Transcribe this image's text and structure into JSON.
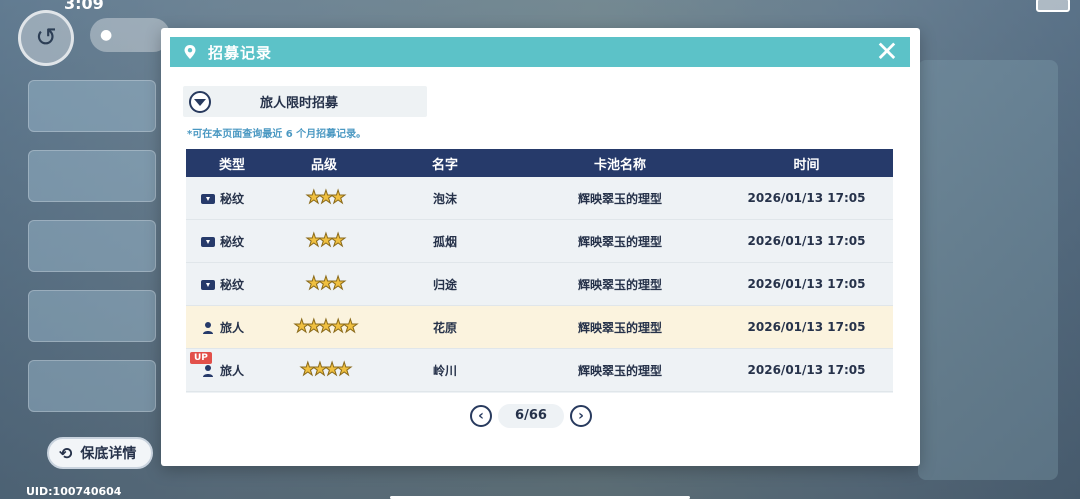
{
  "status": {
    "time": "3:09"
  },
  "background": {
    "location_label": ""
  },
  "dialog": {
    "title": "招募记录",
    "pool_name": "旅人限时招募",
    "note": "*可在本页面查询最近 6 个月招募记录。",
    "columns": [
      "类型",
      "品级",
      "名字",
      "卡池名称",
      "时间"
    ],
    "rows": [
      {
        "type": "秘纹",
        "type_icon": "card-icon",
        "rarity": "★★★",
        "rarity_count": 3,
        "name": "泡沫",
        "pool": "辉映翠玉的理型",
        "time": "2026/01/13 17:05",
        "highlight": false,
        "up": ""
      },
      {
        "type": "秘纹",
        "type_icon": "card-icon",
        "rarity": "★★★",
        "rarity_count": 3,
        "name": "孤烟",
        "pool": "辉映翠玉的理型",
        "time": "2026/01/13 17:05",
        "highlight": false,
        "up": ""
      },
      {
        "type": "秘纹",
        "type_icon": "card-icon",
        "rarity": "★★★",
        "rarity_count": 3,
        "name": "归途",
        "pool": "辉映翠玉的理型",
        "time": "2026/01/13 17:05",
        "highlight": false,
        "up": ""
      },
      {
        "type": "旅人",
        "type_icon": "person-icon",
        "rarity": "★★★★★",
        "rarity_count": 5,
        "name": "花原",
        "pool": "辉映翠玉的理型",
        "time": "2026/01/13 17:05",
        "highlight": true,
        "up": ""
      },
      {
        "type": "旅人",
        "type_icon": "person-icon",
        "rarity": "★★★★",
        "rarity_count": 4,
        "name": "岭川",
        "pool": "辉映翠玉的理型",
        "time": "2026/01/13 17:05",
        "highlight": false,
        "up": "UP"
      }
    ],
    "pager": {
      "current": "6/66"
    }
  },
  "pity_button": {
    "label": "保底详情"
  },
  "uid": "UID:100740604",
  "colors": {
    "header_teal": "#5cc2c8",
    "table_header_navy": "#263a6a",
    "highlight_row": "#fbf3de",
    "star_gold": "#f0c040",
    "up_red": "#e2504a"
  }
}
